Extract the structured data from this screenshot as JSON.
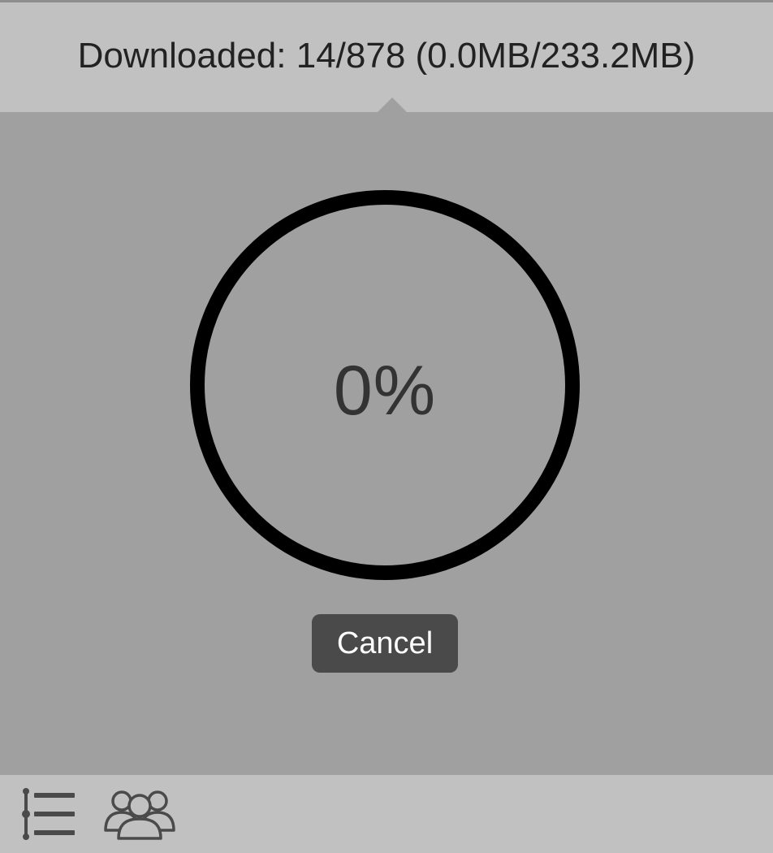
{
  "header": {
    "download_status": "Downloaded: 14/878 (0.0MB/233.2MB)"
  },
  "progress": {
    "label": "0%",
    "value": 0
  },
  "actions": {
    "cancel_label": "Cancel"
  },
  "footer": {
    "icons": [
      "list-icon",
      "group-icon"
    ]
  },
  "colors": {
    "background": "#a0a0a0",
    "header_bg": "#c1c1c1",
    "ring": "#000000",
    "button_bg": "#4a4a4a",
    "icon": "#4a4a4a"
  }
}
